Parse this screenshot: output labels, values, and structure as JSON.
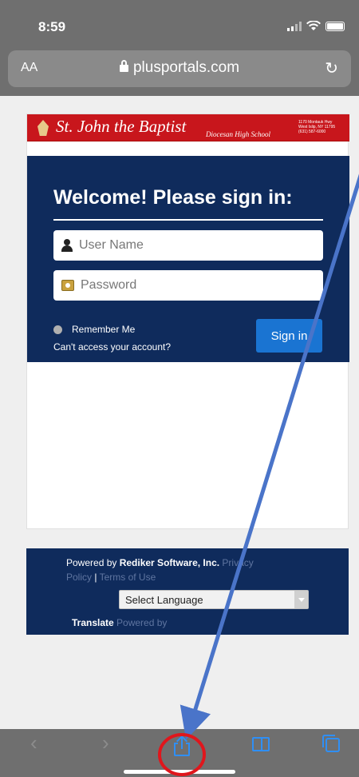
{
  "status_bar": {
    "time": "8:59"
  },
  "address_bar": {
    "text_size_label": "AA",
    "url": "plusportals.com",
    "reload_icon": "reload-icon"
  },
  "header": {
    "school_name": "St. John the Baptist",
    "school_subtitle": "Diocesan High School",
    "address_lines": [
      "1170 Montauk Hwy",
      "West Islip, NY 11795",
      "(631) 587-6000"
    ]
  },
  "login": {
    "title": "Welcome! Please sign in:",
    "username_placeholder": "User Name",
    "password_placeholder": "Password",
    "remember_label": "Remember Me",
    "cant_access_label": "Can't access your account?",
    "signin_label": "Sign in"
  },
  "footer": {
    "powered_by_prefix": "Powered by ",
    "company": "Rediker Software, Inc.",
    "privacy_part1": " Privacy",
    "privacy_part2": "Policy",
    "separator": " | ",
    "terms": "Terms of Use",
    "language_select": "Select Language",
    "translate": "Translate",
    "translate_powered": " Powered by"
  },
  "toolbar": {
    "back_icon": "back-icon",
    "forward_icon": "forward-icon",
    "share_icon": "share-icon",
    "bookmarks_icon": "bookmarks-icon",
    "tabs_icon": "tabs-icon"
  },
  "colors": {
    "navy": "#0f2b5c",
    "brand_red": "#c8161c",
    "ios_blue": "#2f8ff5",
    "annotation_arrow": "#4a74c9",
    "annotation_circle": "#e0161c"
  }
}
